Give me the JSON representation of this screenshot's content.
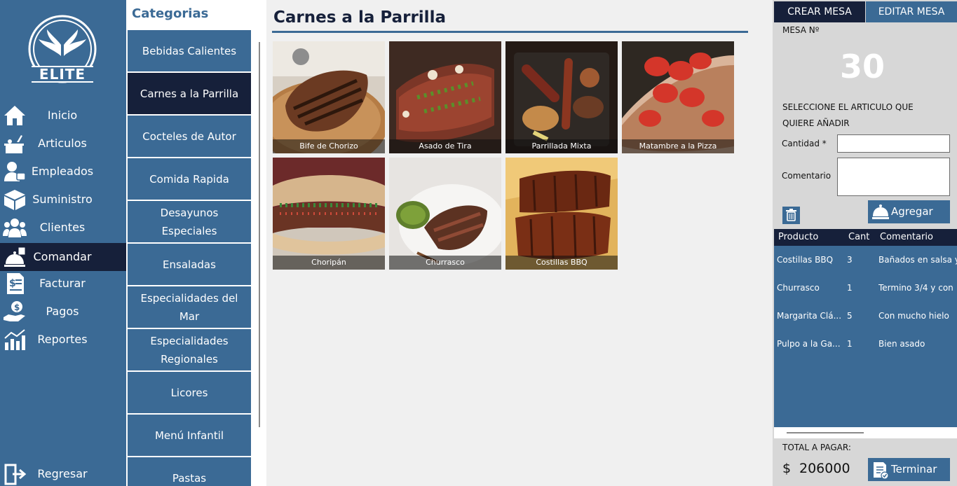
{
  "logo": {
    "text": "ELITE"
  },
  "nav": {
    "items": [
      {
        "label": "Inicio",
        "icon": "home-icon"
      },
      {
        "label": "Articulos",
        "icon": "food-tray-icon"
      },
      {
        "label": "Empleados",
        "icon": "employee-icon"
      },
      {
        "label": "Suministro",
        "icon": "box-icon"
      },
      {
        "label": "Clientes",
        "icon": "clients-icon"
      },
      {
        "label": "Comandar",
        "icon": "cloche-order-icon",
        "active": true
      },
      {
        "label": "Facturar",
        "icon": "invoice-icon"
      },
      {
        "label": "Pagos",
        "icon": "payment-hand-icon"
      },
      {
        "label": "Reportes",
        "icon": "reports-chart-icon"
      }
    ],
    "back": {
      "label": "Regresar",
      "icon": "exit-door-icon"
    }
  },
  "categories": {
    "title": "Categorias",
    "items": [
      {
        "label": "Bebidas Calientes"
      },
      {
        "label": "Carnes a la Parrilla",
        "active": true
      },
      {
        "label": "Cocteles de Autor"
      },
      {
        "label": "Comida Rapida"
      },
      {
        "label": "Desayunos Especiales"
      },
      {
        "label": "Ensaladas"
      },
      {
        "label": "Especialidades del Mar"
      },
      {
        "label": "Especialidades Regionales"
      },
      {
        "label": "Licores"
      },
      {
        "label": "Menú Infantil"
      },
      {
        "label": "Pastas"
      }
    ]
  },
  "main": {
    "title": "Carnes a la Parrilla",
    "products": [
      {
        "name": "Bife de Chorizo"
      },
      {
        "name": "Asado de Tira"
      },
      {
        "name": "Parrillada Mixta"
      },
      {
        "name": "Matambre a la Pizza"
      },
      {
        "name": "Choripán"
      },
      {
        "name": "Churrasco"
      },
      {
        "name": "Costillas BBQ"
      }
    ]
  },
  "order": {
    "tabs": {
      "create": "CREAR MESA",
      "edit": "EDITAR MESA"
    },
    "mesa_label": "MESA Nº",
    "mesa_number": "30",
    "select_msg_line1": "SELECCIONE EL ARTICULO QUE",
    "select_msg_line2": "QUIERE AÑADIR",
    "cantidad_label": "Cantidad *",
    "cantidad_value": "",
    "comentario_label": "Comentario",
    "comentario_value": "",
    "add_label": "Agregar",
    "delete_icon": "trash-icon",
    "add_icon": "cloche-icon",
    "finish_icon": "document-check-icon",
    "columns": {
      "product": "Producto",
      "qty": "Cant",
      "comment": "Comentario"
    },
    "rows": [
      {
        "product": "Costillas BBQ",
        "qty": "3",
        "comment": "Bañados en salsa y"
      },
      {
        "product": "Churrasco",
        "qty": "1",
        "comment": "Termino 3/4 y con"
      },
      {
        "product": "Margarita Clá...",
        "qty": "5",
        "comment": "Con mucho hielo"
      },
      {
        "product": "Pulpo a la Ga...",
        "qty": "1",
        "comment": "Bien asado"
      }
    ],
    "total_label": "TOTAL A PAGAR:",
    "currency": "$",
    "total_value": "206000",
    "finish_label": "Terminar"
  },
  "colors": {
    "primary": "#3b6a95",
    "dark": "#16203a",
    "panel": "#d7d7d7",
    "background": "#f0f0f0"
  }
}
